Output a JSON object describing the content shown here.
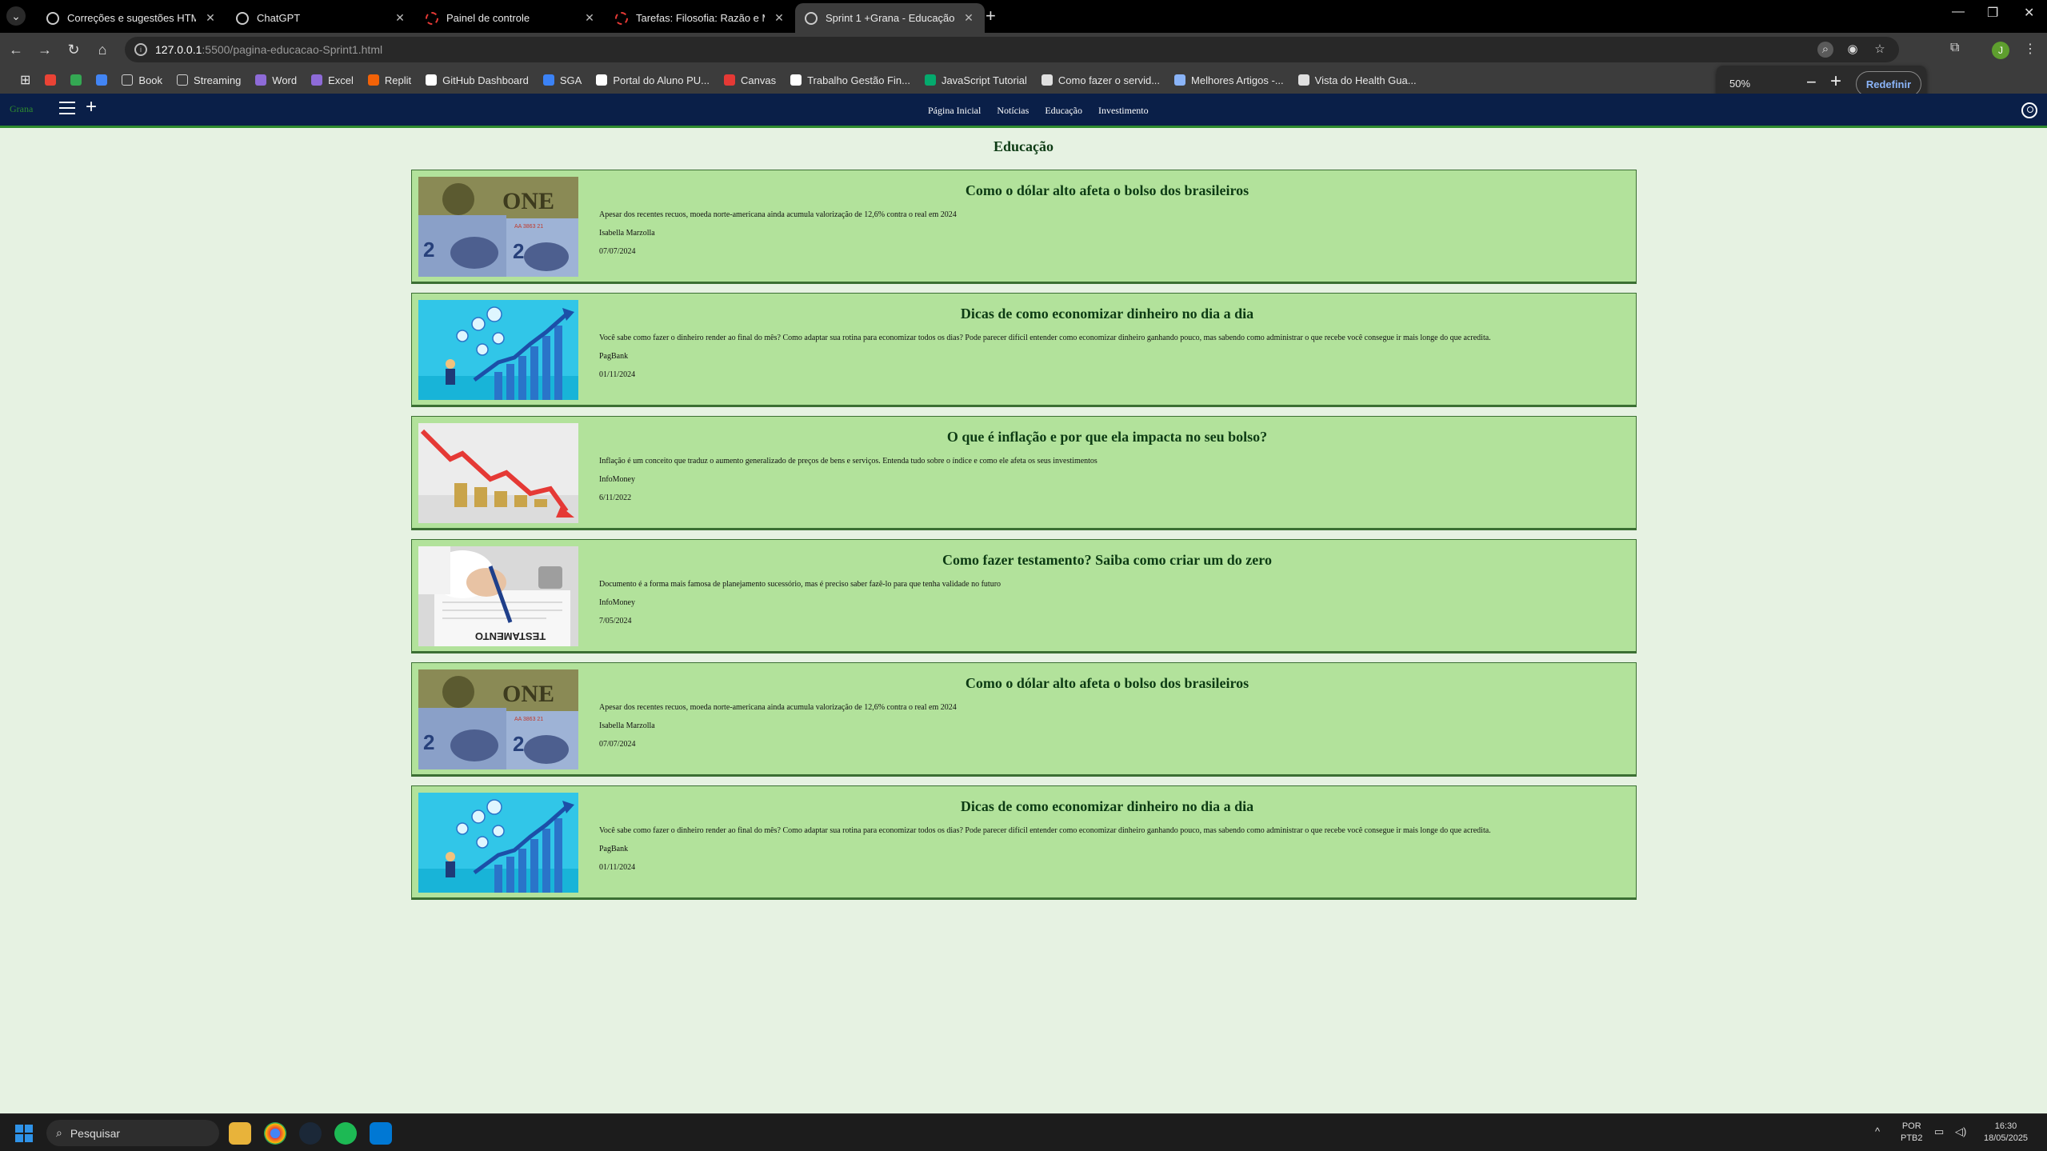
{
  "browser": {
    "tabs": [
      {
        "label": "Correções e sugestões HTML",
        "icon": "globe-icon",
        "active": false
      },
      {
        "label": "ChatGPT",
        "icon": "globe-icon",
        "active": false
      },
      {
        "label": "Painel de controle",
        "icon": "loading-icon",
        "active": false
      },
      {
        "label": "Tarefas: Filosofia: Razão e Mod",
        "icon": "loading-icon",
        "active": false
      },
      {
        "label": "Sprint 1 +Grana - Educação",
        "icon": "globe-icon",
        "active": true
      }
    ],
    "url_host": "127.0.0.1",
    "url_path": ":5500/pagina-educacao-Sprint1.html",
    "profile_initial": "J",
    "bookmarks": [
      {
        "label": "",
        "icon": "gmail-icon",
        "color": "#ea4335"
      },
      {
        "label": "",
        "icon": "drive-icon",
        "color": "#34a853"
      },
      {
        "label": "",
        "icon": "docs-icon",
        "color": "#4285f4"
      },
      {
        "label": "Book",
        "icon": "folder-icon",
        "color": "#cfcfcf"
      },
      {
        "label": "Streaming",
        "icon": "folder-icon",
        "color": "#cfcfcf"
      },
      {
        "label": "Word",
        "icon": "word-icon",
        "color": "#8e6bd8"
      },
      {
        "label": "Excel",
        "icon": "excel-icon",
        "color": "#8e6bd8"
      },
      {
        "label": "Replit",
        "icon": "replit-icon",
        "color": "#f26207"
      },
      {
        "label": "GitHub Dashboard",
        "icon": "github-icon",
        "color": "#ffffff"
      },
      {
        "label": "SGA",
        "icon": "sga-icon",
        "color": "#3b82f6"
      },
      {
        "label": "Portal do Aluno PU...",
        "icon": "portal-icon",
        "color": "#ffffff"
      },
      {
        "label": "Canvas",
        "icon": "canvas-icon",
        "color": "#e53935"
      },
      {
        "label": "Trabalho Gestão Fin...",
        "icon": "github-icon",
        "color": "#ffffff"
      },
      {
        "label": "JavaScript Tutorial",
        "icon": "w3-icon",
        "color": "#04aa6d"
      },
      {
        "label": "Como fazer o servid...",
        "icon": "page-icon",
        "color": "#e0e0e0"
      },
      {
        "label": "Melhores Artigos -...",
        "icon": "article-icon",
        "color": "#8ab4f8"
      },
      {
        "label": "Vista do Health Gua...",
        "icon": "pdf-icon",
        "color": "#e0e0e0"
      }
    ],
    "zoom": {
      "value": "50%",
      "minus": "−",
      "plus": "+",
      "reset_label": "Redefinir"
    }
  },
  "site": {
    "logo": "Grana",
    "menu": [
      "Página Inicial",
      "Notícias",
      "Educação",
      "Investimento"
    ],
    "page_title": "Educação",
    "articles": [
      {
        "title": "Como o dólar alto afeta o bolso dos brasileiros",
        "description": "Apesar dos recentes recuos, moeda norte-americana ainda acumula valorização de 12,6% contra o real em 2024",
        "author": "Isabella Marzolla",
        "date": "07/07/2024",
        "image": "dollar-real-banknotes"
      },
      {
        "title": "Dicas de como economizar dinheiro no dia a dia",
        "description": "Você sabe como fazer o dinheiro render ao final do mês? Como adaptar sua rotina para economizar todos os dias? Pode parecer difícil entender como economizar dinheiro ganhando pouco, mas sabendo como administrar o que recebe você consegue ir mais longe do que acredita.",
        "author": "PagBank",
        "date": "01/11/2024",
        "image": "growth-chart-coins"
      },
      {
        "title": "O que é inflação e por que ela impacta no seu bolso?",
        "description": "Inflação é um conceito que traduz o aumento generalizado de preços de bens e serviços. Entenda tudo sobre o índice e como ele afeta os seus investimentos",
        "author": "InfoMoney",
        "date": "6/11/2022",
        "image": "falling-arrow-coins"
      },
      {
        "title": "Como fazer testamento? Saiba como criar um do zero",
        "description": "Documento é a forma mais famosa de planejamento sucessório, mas é preciso saber fazê-lo para que tenha validade no futuro",
        "author": "InfoMoney",
        "date": "7/05/2024",
        "image": "testament-signing",
        "image_text": "TESTAMENTO"
      },
      {
        "title": "Como o dólar alto afeta o bolso dos brasileiros",
        "description": "Apesar dos recentes recuos, moeda norte-americana ainda acumula valorização de 12,6% contra o real em 2024",
        "author": "Isabella Marzolla",
        "date": "07/07/2024",
        "image": "dollar-real-banknotes"
      },
      {
        "title": "Dicas de como economizar dinheiro no dia a dia",
        "description": "Você sabe como fazer o dinheiro render ao final do mês? Como adaptar sua rotina para economizar todos os dias? Pode parecer difícil entender como economizar dinheiro ganhando pouco, mas sabendo como administrar o que recebe você consegue ir mais longe do que acredita.",
        "author": "PagBank",
        "date": "01/11/2024",
        "image": "growth-chart-coins"
      }
    ]
  },
  "taskbar": {
    "search_placeholder": "Pesquisar",
    "language": "POR",
    "layout": "PTB2",
    "time": "16:30",
    "date": "18/05/2025"
  },
  "colors": {
    "nav_bg": "#0a1f48",
    "card_bg": "#b2e29b",
    "page_bg": "#e6f2e2",
    "accent_green": "#2e8b2e"
  }
}
